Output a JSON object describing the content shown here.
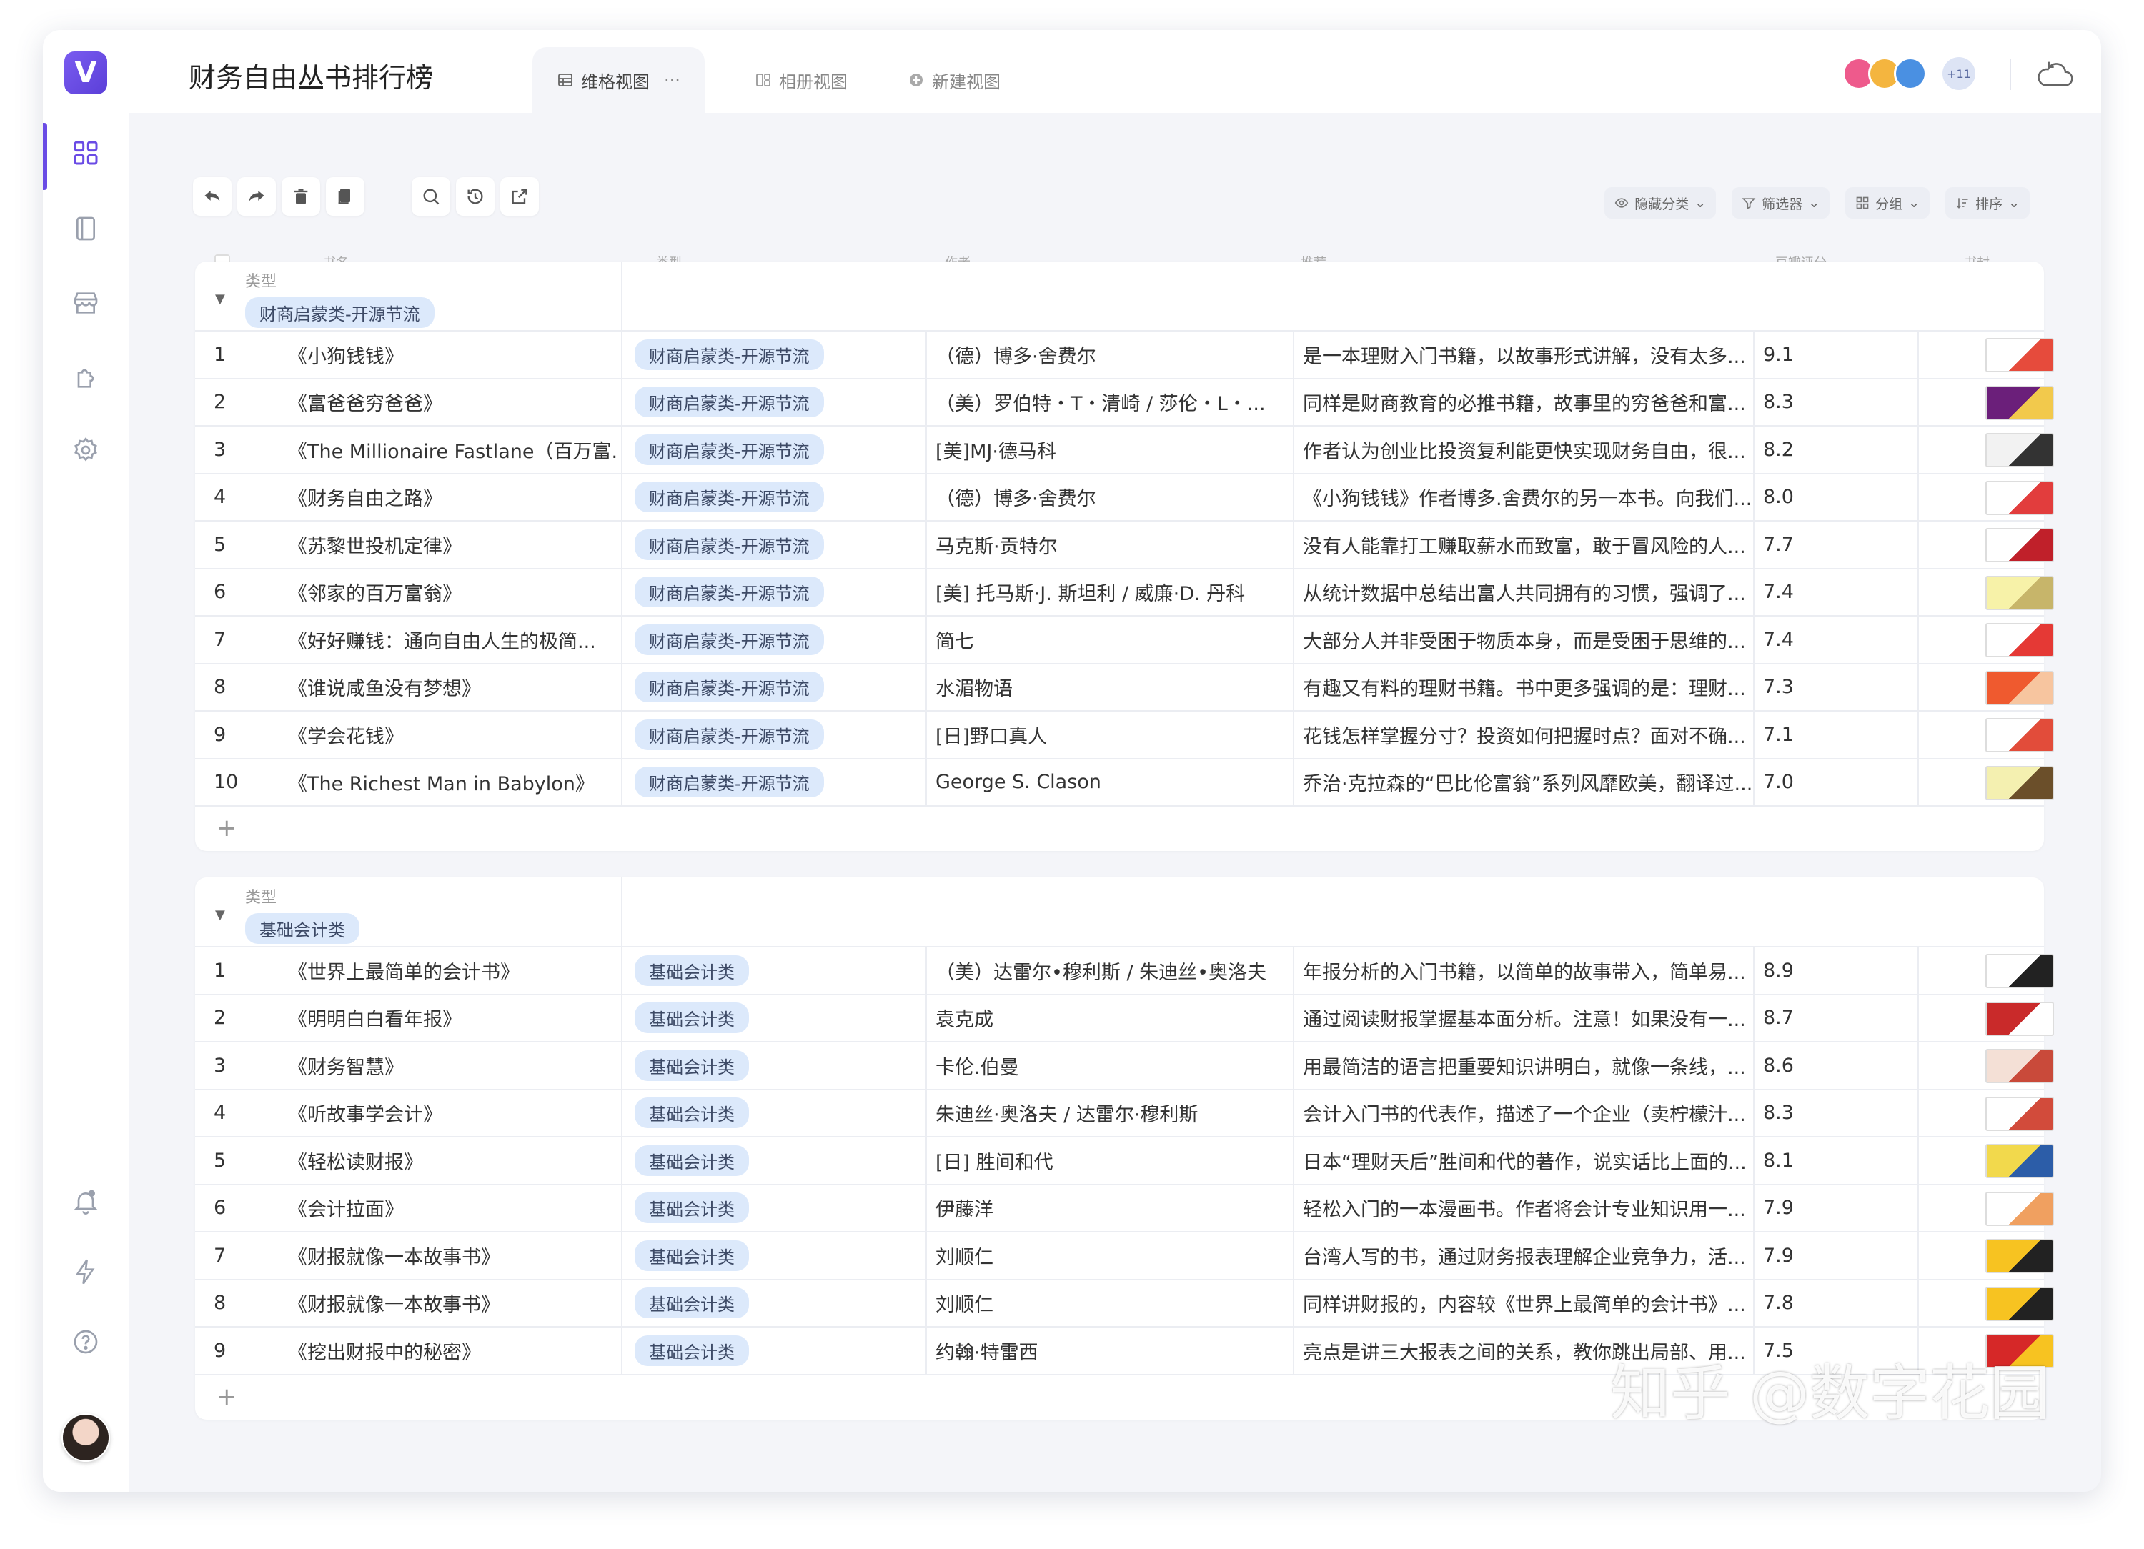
{
  "app": {
    "title": "财务自由丛书排行榜",
    "brand_color": "#6a4be5"
  },
  "tabs": [
    {
      "label": "维格视图",
      "more": "···"
    },
    {
      "label": "相册视图"
    },
    {
      "label": "新建视图"
    }
  ],
  "presence": {
    "more": "+11"
  },
  "filters": {
    "hide": "隐藏分类",
    "filter": "筛选器",
    "group": "分组",
    "sort": "排序"
  },
  "columns": {
    "name": "书名",
    "type": "类型",
    "author": "作者",
    "recommend": "推荐",
    "score": "豆瓣评分",
    "cover": "书封"
  },
  "groups": [
    {
      "label": "类型",
      "tag": "财商启蒙类-开源节流",
      "rows": [
        {
          "idx": "1",
          "name": "《小狗钱钱》",
          "type": "财商启蒙类-开源节流",
          "author": "（德）博多·舍费尔",
          "rec": "是一本理财入门书籍，以故事形式讲解，没有太多...",
          "score": "9.1"
        },
        {
          "idx": "2",
          "name": "《富爸爸穷爸爸》",
          "type": "财商启蒙类-开源节流",
          "author": "（美）罗伯特・T・清崎 / 莎伦・L・...",
          "rec": "同样是财商教育的必推书籍，故事里的穷爸爸和富...",
          "score": "8.3"
        },
        {
          "idx": "3",
          "name": "《The Millionaire Fastlane（百万富...",
          "type": "财商启蒙类-开源节流",
          "author": "[美]MJ·德马科",
          "rec": "作者认为创业比投资复利能更快实现财务自由，很...",
          "score": "8.2"
        },
        {
          "idx": "4",
          "name": "《财务自由之路》",
          "type": "财商启蒙类-开源节流",
          "author": "（德）博多·舍费尔",
          "rec": "《小狗钱钱》作者博多.舍费尔的另一本书。向我们...",
          "score": "8.0"
        },
        {
          "idx": "5",
          "name": "《苏黎世投机定律》",
          "type": "财商启蒙类-开源节流",
          "author": "马克斯·贡特尔",
          "rec": "没有人能靠打工赚取薪水而致富，敢于冒风险的人...",
          "score": "7.7"
        },
        {
          "idx": "6",
          "name": "《邻家的百万富翁》",
          "type": "财商启蒙类-开源节流",
          "author": "[美] 托马斯·J. 斯坦利 / 威廉·D. 丹科",
          "rec": "从统计数据中总结出富人共同拥有的习惯，强调了...",
          "score": "7.4"
        },
        {
          "idx": "7",
          "name": "《好好赚钱：通向自由人生的极简...",
          "type": "财商启蒙类-开源节流",
          "author": "简七",
          "rec": "大部分人并非受困于物质本身，而是受困于思维的...",
          "score": "7.4"
        },
        {
          "idx": "8",
          "name": "《谁说咸鱼没有梦想》",
          "type": "财商启蒙类-开源节流",
          "author": "水湄物语",
          "rec": "有趣又有料的理财书籍。书中更多强调的是：理财...",
          "score": "7.3"
        },
        {
          "idx": "9",
          "name": "《学会花钱》",
          "type": "财商启蒙类-开源节流",
          "author": "[日]野口真人",
          "rec": "花钱怎样掌握分寸？投资如何把握时点？面对不确...",
          "score": "7.1"
        },
        {
          "idx": "10",
          "name": "《The Richest Man in Babylon》",
          "type": "财商启蒙类-开源节流",
          "author": "George S. Clason",
          "rec": "乔治·克拉森的“巴比伦富翁”系列风靡欧美，翻译过...",
          "score": "7.0"
        }
      ]
    },
    {
      "label": "类型",
      "tag": "基础会计类",
      "rows": [
        {
          "idx": "1",
          "name": "《世界上最简单的会计书》",
          "type": "基础会计类",
          "author": "（美）达雷尔•穆利斯 / 朱迪丝•奥洛夫",
          "rec": "年报分析的入门书籍，以简单的故事带入，简单易...",
          "score": "8.9"
        },
        {
          "idx": "2",
          "name": "《明明白白看年报》",
          "type": "基础会计类",
          "author": "袁克成",
          "rec": "通过阅读财报掌握基本面分析。注意！如果没有一...",
          "score": "8.7"
        },
        {
          "idx": "3",
          "name": "《财务智慧》",
          "type": "基础会计类",
          "author": "卡伦.伯曼",
          "rec": "用最简洁的语言把重要知识讲明白，就像一条线，...",
          "score": "8.6"
        },
        {
          "idx": "4",
          "name": "《听故事学会计》",
          "type": "基础会计类",
          "author": "朱迪丝·奥洛夫 / 达雷尔·穆利斯",
          "rec": "会计入门书的代表作，描述了一个企业（卖柠檬汁...",
          "score": "8.3"
        },
        {
          "idx": "5",
          "name": "《轻松读财报》",
          "type": "基础会计类",
          "author": "[日] 胜间和代",
          "rec": "日本“理财天后”胜间和代的著作，说实话比上面的...",
          "score": "8.1"
        },
        {
          "idx": "6",
          "name": "《会计拉面》",
          "type": "基础会计类",
          "author": "伊藤洋",
          "rec": "轻松入门的一本漫画书。作者将会计专业知识用一...",
          "score": "7.9"
        },
        {
          "idx": "7",
          "name": "《财报就像一本故事书》",
          "type": "基础会计类",
          "author": "刘顺仁",
          "rec": "台湾人写的书，通过财务报表理解企业竞争力，活...",
          "score": "7.9"
        },
        {
          "idx": "8",
          "name": "《财报就像一本故事书》",
          "type": "基础会计类",
          "author": "刘顺仁",
          "rec": "同样讲财报的，内容较《世界上最简单的会计书》...",
          "score": "7.8"
        },
        {
          "idx": "9",
          "name": "《挖出财报中的秘密》",
          "type": "基础会计类",
          "author": "约翰·特雷西",
          "rec": "亮点是讲三大报表之间的关系，教你跳出局部、用...",
          "score": "7.5"
        }
      ]
    }
  ],
  "watermark": "知乎 @数字花园"
}
